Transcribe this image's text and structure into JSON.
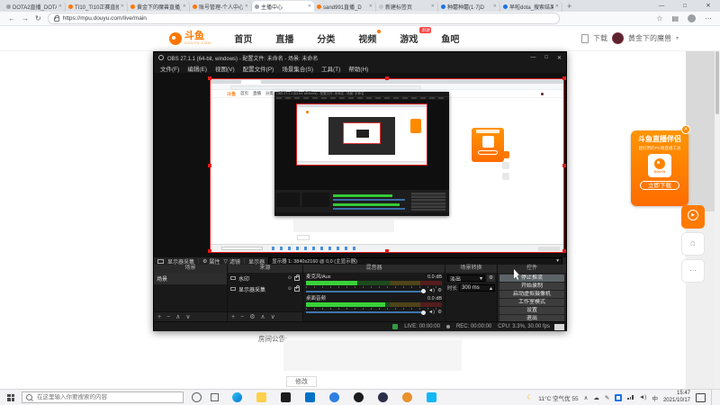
{
  "browser": {
    "tabs": [
      {
        "label": "DOTA2直播_DOTA2赛",
        "favicon_color": "#9aa0a6"
      },
      {
        "label": "TI10_TI10正赛直播",
        "favicon_color": "#ff7700"
      },
      {
        "label": "黄金下的魔兽直播_D",
        "favicon_color": "#ff7700"
      },
      {
        "label": "账号管理-个人中心",
        "favicon_color": "#ff7700"
      },
      {
        "label": "主播中心",
        "favicon_color": "#9aa0a6"
      },
      {
        "label": "sand991直播_D",
        "favicon_color": "#ff7700"
      },
      {
        "label": "新建标签页",
        "favicon_color": "#c4c7cb"
      },
      {
        "label": "种蘑种蘑(1·7)D",
        "favicon_color": "#1a73e8"
      },
      {
        "label": "早啦dota_搜索结果_",
        "favicon_color": "#1a73e8"
      }
    ],
    "tab_close": "✕",
    "new_tab": "+",
    "window_controls": {
      "minimize": "—",
      "maximize": "□",
      "close": "✕"
    },
    "nav": {
      "back": "←",
      "forward": "→",
      "refresh": "↻"
    },
    "address": {
      "url": "https://mpu.douyu.com/live/main"
    },
    "toolbar_icons": {
      "favorites": "☆",
      "collections": "▤",
      "more": "⋯"
    }
  },
  "douyu": {
    "logo_main": "斗鱼",
    "logo_sub": "DOUYU.COM",
    "nav": [
      {
        "label": "首页"
      },
      {
        "label": "直播"
      },
      {
        "label": "分类"
      },
      {
        "label": "视频"
      },
      {
        "label": "游戏",
        "badge": "新游"
      },
      {
        "label": "鱼吧"
      }
    ],
    "download": "下载",
    "username": "黄金下的魔兽",
    "caret": "▾"
  },
  "obs": {
    "title": "OBS 27.1.1 (64-bit, windows) - 配置文件: 未命名 - 场景: 未命名",
    "menus": [
      "文件(F)",
      "编辑(E)",
      "视图(V)",
      "配置文件(P)",
      "场景集合(S)",
      "工具(T)",
      "帮助(H)"
    ],
    "window_controls": {
      "minimize": "—",
      "maximize": "□",
      "close": "✕"
    },
    "source_toolbar": {
      "source": "显示器采集",
      "properties": "属性",
      "filters": "滤镜",
      "monitor_label": "显示器",
      "monitor_value": "显示器 1: 3840x2160 @ 0,0 (主显示器)"
    },
    "scenes": {
      "title": "场景",
      "items": [
        {
          "name": "场景"
        }
      ]
    },
    "sources": {
      "title": "来源",
      "items": [
        {
          "name": "水印"
        },
        {
          "name": "显示器采集"
        }
      ]
    },
    "mixer": {
      "title": "混音器",
      "channels": [
        {
          "name": "麦克风/Aux",
          "db": "0.0 dB",
          "level": "38%"
        },
        {
          "name": "桌面音频",
          "db": "0.0 dB",
          "level": "58%"
        }
      ]
    },
    "transitions": {
      "title": "场景转换",
      "value": "淡出",
      "duration_label": "时长",
      "duration": "300 ms"
    },
    "controls": {
      "title": "控件",
      "buttons": [
        {
          "label": "停止推流"
        },
        {
          "label": "开始录制"
        },
        {
          "label": "启动虚拟摄像机"
        },
        {
          "label": "工作室模式"
        },
        {
          "label": "设置"
        },
        {
          "label": "退出"
        }
      ]
    },
    "status": {
      "live": "LIVE: 00:00:00",
      "rec": "REC: 00:00:00",
      "cpu": "CPU: 3.3%, 30.00 fps"
    },
    "icons": {
      "gear": "⚙",
      "funnel": "▽",
      "eye": "⊙",
      "up": "∧",
      "down": "∨",
      "add": "+",
      "remove": "−",
      "spin_up": "▴",
      "spin_down": "▾",
      "speaker": "◄)",
      "dropdown": "▾"
    }
  },
  "page": {
    "announcement_label": "房间公告:",
    "modify_button": "修改"
  },
  "promo": {
    "title": "斗鱼直播伴侣",
    "subtitle": "超好用的PC端直播工具",
    "logo_text": "DOUYU",
    "download_button": "立即下载",
    "close": "✕",
    "play_glyph": "▶",
    "home_glyph": "⌂",
    "more_glyph": "⋯"
  },
  "taskbar": {
    "search_placeholder": "在这里输入你要搜索的内容",
    "weather": "11°C 空气优 55",
    "ime": "中",
    "time": "15:47",
    "date": "2021/10/17",
    "tray": {
      "moon": "☾",
      "chevron": "∧",
      "cloud": "☁",
      "pen": "✎",
      "volume": "◄)"
    }
  }
}
